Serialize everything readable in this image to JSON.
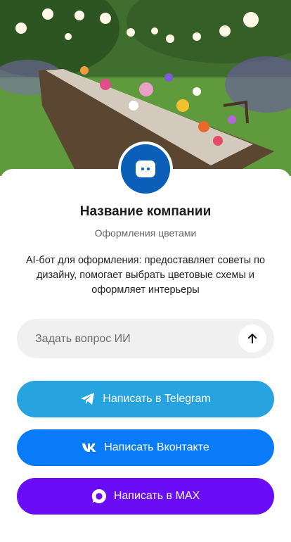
{
  "header": {
    "hero_image": "garden-table-flowers-photo"
  },
  "profile": {
    "logo_icon": "chat-bubble-icon",
    "company_name": "Название компании",
    "category": "Оформления цветами",
    "description": "AI-бот для оформления: предоставляет советы по дизайну, помогает выбрать цветовые схемы и оформляет интерьеры"
  },
  "ask": {
    "placeholder": "Задать вопрос ИИ",
    "send_icon": "arrow-up-icon"
  },
  "buttons": {
    "telegram": {
      "label": "Написать в Telegram",
      "icon": "telegram-icon",
      "color": "#27a3e0"
    },
    "vk": {
      "label": "Написать Вконтакте",
      "icon": "vk-icon",
      "color": "#0a7bf8"
    },
    "max": {
      "label": "Написать в MAX",
      "icon": "max-icon",
      "color": "#6b0cf7"
    }
  }
}
